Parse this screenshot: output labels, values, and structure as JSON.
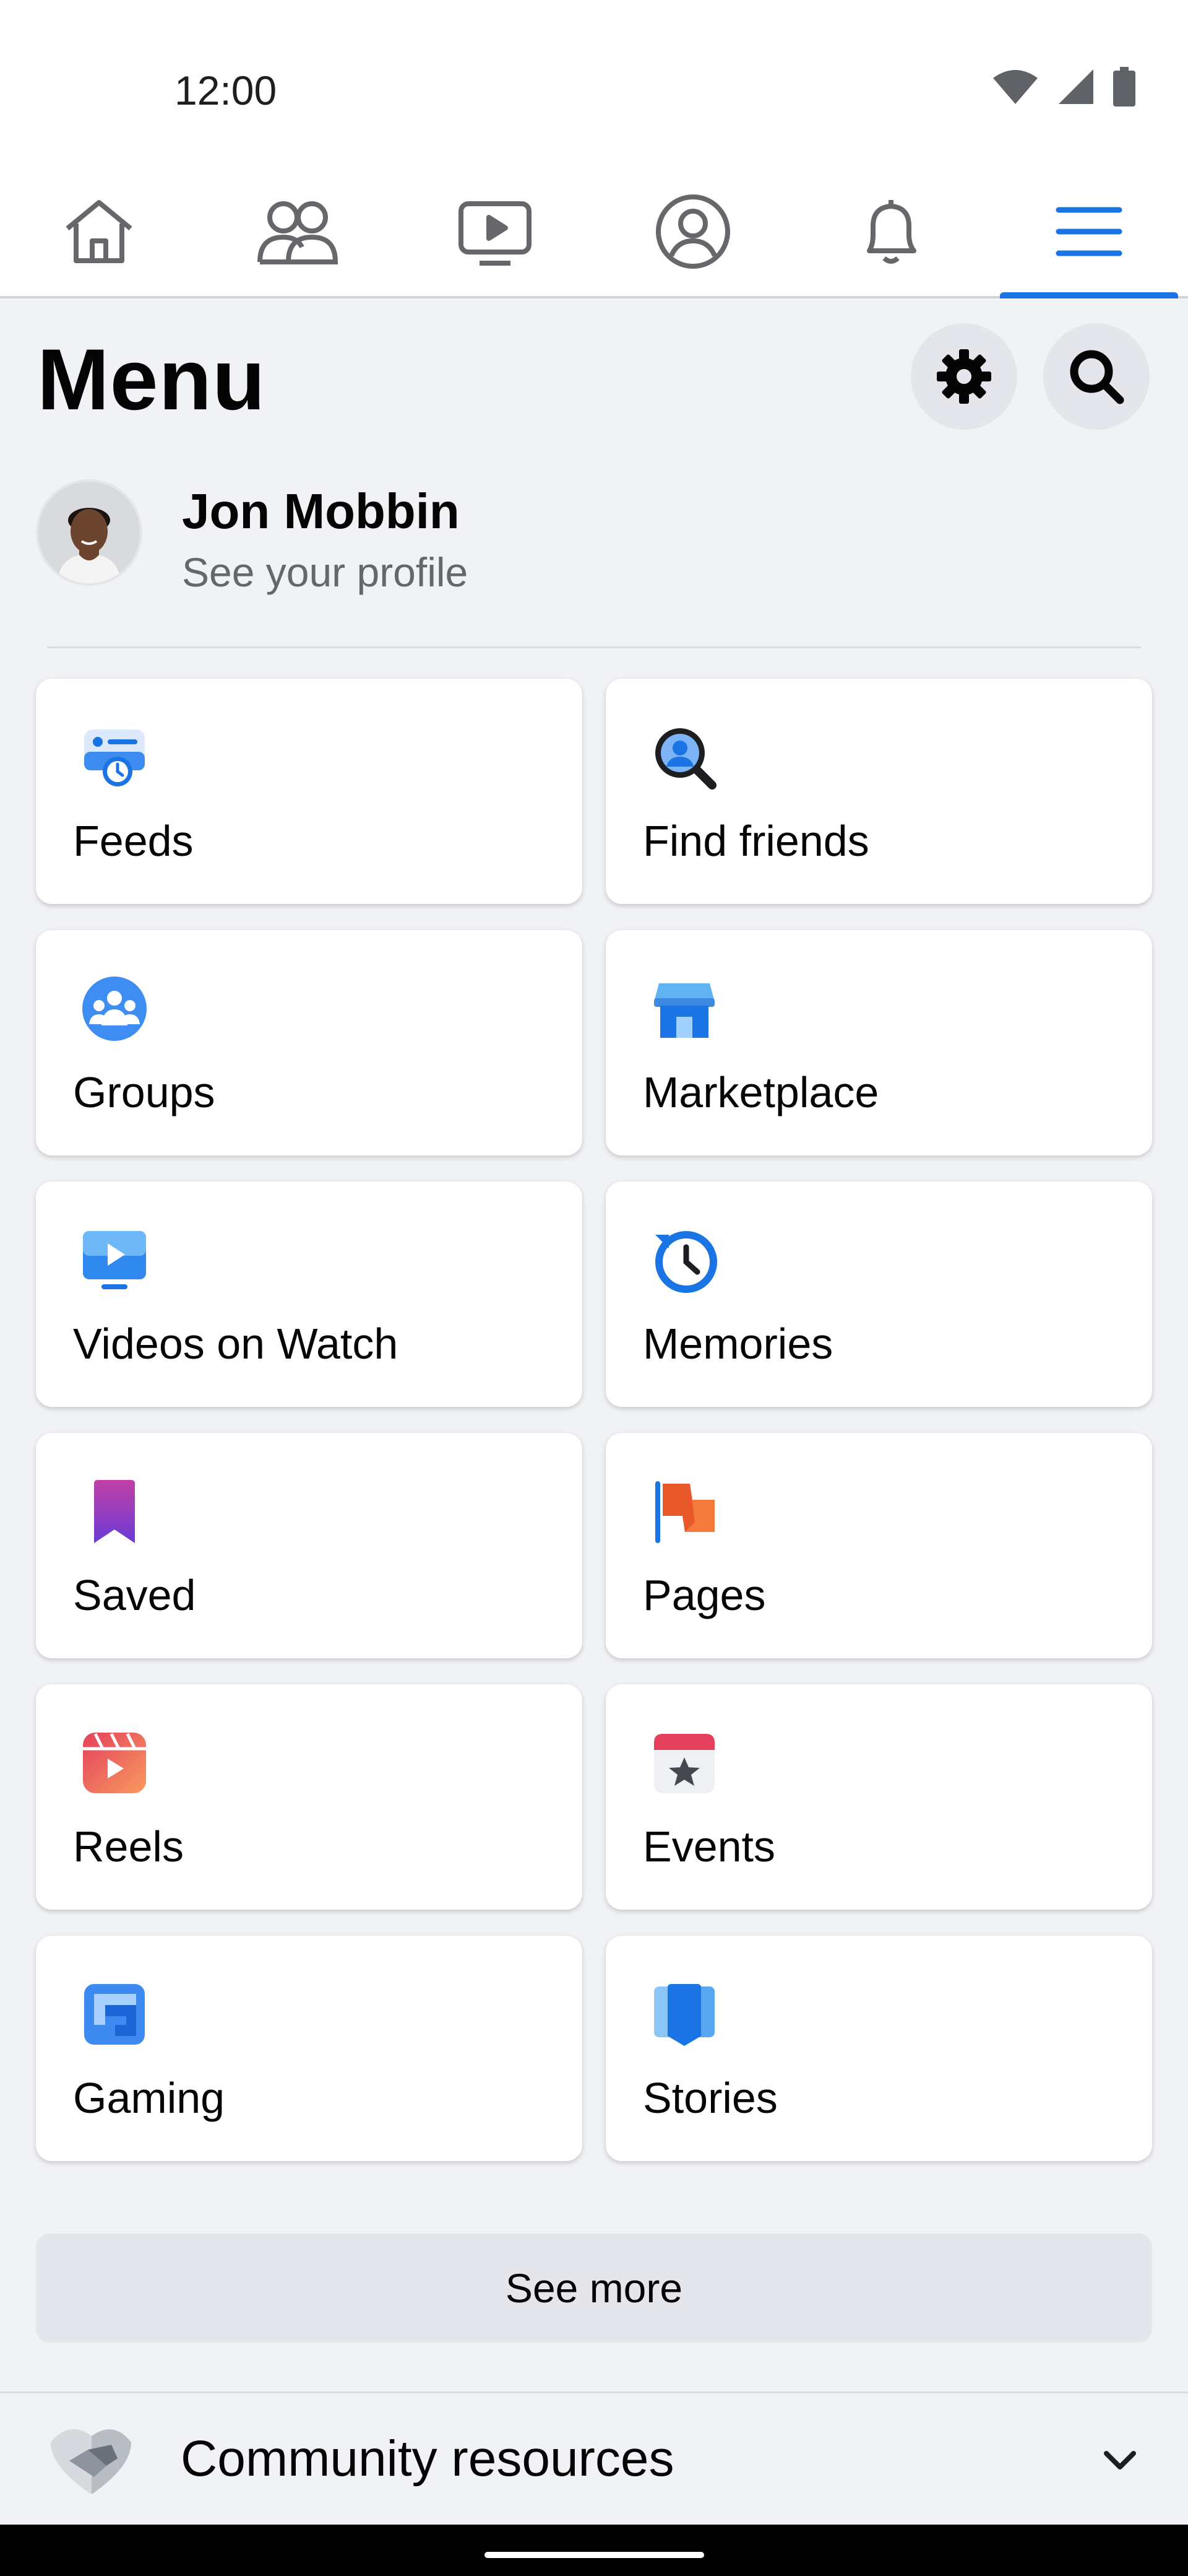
{
  "status_bar": {
    "time": "12:00"
  },
  "nav_tabs": [
    {
      "name": "Home",
      "icon": "home-icon",
      "active": false
    },
    {
      "name": "Friends",
      "icon": "friends-icon",
      "active": false
    },
    {
      "name": "Watch",
      "icon": "video-icon",
      "active": false
    },
    {
      "name": "Profile",
      "icon": "profile-icon",
      "active": false
    },
    {
      "name": "Notifications",
      "icon": "bell-icon",
      "active": false
    },
    {
      "name": "Menu",
      "icon": "hamburger-icon",
      "active": true
    }
  ],
  "menu": {
    "title": "Menu",
    "settings_icon": "gear-icon",
    "search_icon": "search-icon"
  },
  "profile": {
    "name": "Jon Mobbin",
    "subtitle": "See your profile"
  },
  "shortcuts": [
    {
      "label": "Feeds",
      "icon": "feeds-icon"
    },
    {
      "label": "Find friends",
      "icon": "find-friends-icon"
    },
    {
      "label": "Groups",
      "icon": "groups-icon"
    },
    {
      "label": "Marketplace",
      "icon": "marketplace-icon"
    },
    {
      "label": "Videos on Watch",
      "icon": "watch-video-icon"
    },
    {
      "label": "Memories",
      "icon": "memories-icon"
    },
    {
      "label": "Saved",
      "icon": "bookmark-icon"
    },
    {
      "label": "Pages",
      "icon": "flag-icon"
    },
    {
      "label": "Reels",
      "icon": "reels-icon"
    },
    {
      "label": "Events",
      "icon": "calendar-star-icon"
    },
    {
      "label": "Gaming",
      "icon": "gaming-icon"
    },
    {
      "label": "Stories",
      "icon": "stories-icon"
    }
  ],
  "see_more": "See more",
  "community": {
    "label": "Community resources",
    "icon": "handshake-icon"
  },
  "colors": {
    "accent": "#1b74e4",
    "background": "#f0f2f5",
    "card": "#ffffff",
    "secondary_text": "#65676b"
  }
}
